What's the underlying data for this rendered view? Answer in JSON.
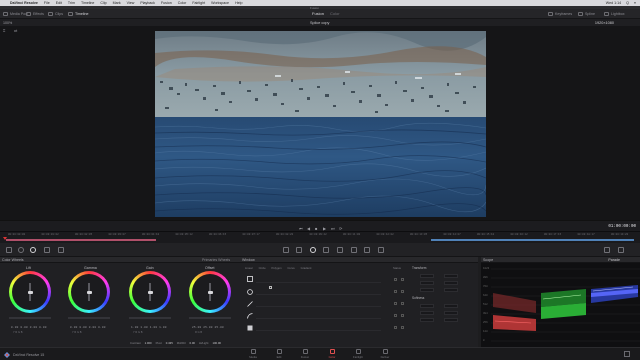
{
  "menubar": {
    "app": "DaVinci Resolve",
    "items": [
      "File",
      "Edit",
      "Trim",
      "Timeline",
      "Clip",
      "Mark",
      "View",
      "Playback",
      "Fusion",
      "Color",
      "Fairlight",
      "Workspace",
      "Help"
    ],
    "right_items": [
      "Wed 1:14",
      "Q",
      "≡"
    ]
  },
  "titlebar": {
    "title": "Fusion"
  },
  "toolbar": {
    "media_pool": "Media Pool",
    "effects": "Effects",
    "clips": "Clips",
    "timeline": "Timeline",
    "mode_active": "Fusion",
    "mode_other": "Color",
    "keyframes": "Keyframes",
    "spline": "Spline",
    "lightbox": "Lightbox"
  },
  "viewer": {
    "zoom": "100%",
    "clip_name": "Splice copy",
    "timecode_top": "1920×1080"
  },
  "transport": {
    "timecode": "01:00:00:00",
    "buttons": [
      "⏮",
      "◀",
      "■",
      "▶",
      "⏭",
      "⟳"
    ]
  },
  "ruler": {
    "ticks": [
      "00:00:00:00",
      "00:00:01:02",
      "00:00:02:05",
      "00:00:03:07",
      "00:00:04:10",
      "00:00:05:12",
      "00:00:06:15",
      "00:00:07:17",
      "00:00:08:20",
      "00:00:09:22",
      "00:00:11:00",
      "00:00:12:02",
      "00:00:13:05",
      "00:00:14:07",
      "00:00:15:10",
      "00:00:16:12",
      "00:00:17:15",
      "00:00:18:17",
      "00:00:19:20"
    ]
  },
  "panels": {
    "color_wheels": "Color Wheels",
    "primaries": "Primaries Wheels",
    "window": "Window",
    "scope": "Scope",
    "scope_mode": "Parade",
    "transform": "Transform",
    "softness": "Softness"
  },
  "wheels": [
    {
      "label": "Lift",
      "values": "0.00  0.00  0.00  0.00",
      "rgb": "Y    R    G    B"
    },
    {
      "label": "Gamma",
      "values": "0.00  0.00  0.00  0.00",
      "rgb": "Y    R    G    B"
    },
    {
      "label": "Gain",
      "values": "1.00  1.00  1.00  1.00",
      "rgb": "Y    R    G    B"
    },
    {
      "label": "Offset",
      "values": "25.00 25.00 25.00",
      "rgb": "R    G    B"
    }
  ],
  "wheel_footer": {
    "contrast_label": "Contrast",
    "contrast": "1.000",
    "pivot_label": "Pivot",
    "pivot": "0.435",
    "mid_label": "Mid/Dtl",
    "mid": "0.00",
    "color_boost_label": "Col Boost",
    "color_boost": "0.00",
    "shadows_label": "Shad",
    "shadows": "0.00",
    "hl_label": "Hi/Light",
    "hl": "100.00"
  },
  "window_tabs": [
    "Linear",
    "Circle",
    "Polygon",
    "Curve",
    "Gradient"
  ],
  "window_col_header": "Status",
  "scope_scale": [
    "1023",
    "896",
    "768",
    "640",
    "512",
    "384",
    "256",
    "128",
    "0"
  ],
  "pages": [
    {
      "label": "Media",
      "icon": "media-page-icon"
    },
    {
      "label": "Edit",
      "icon": "edit-page-icon"
    },
    {
      "label": "Fusion",
      "icon": "fusion-page-icon"
    },
    {
      "label": "Color",
      "icon": "color-page-icon"
    },
    {
      "label": "Fairlight",
      "icon": "fairlight-page-icon"
    },
    {
      "label": "Deliver",
      "icon": "deliver-page-icon"
    }
  ],
  "app_footer": "DaVinci Resolve 15",
  "colors": {
    "accent": "#e05050",
    "timeline_red": "#b0506a",
    "timeline_blue": "#5082b8"
  }
}
